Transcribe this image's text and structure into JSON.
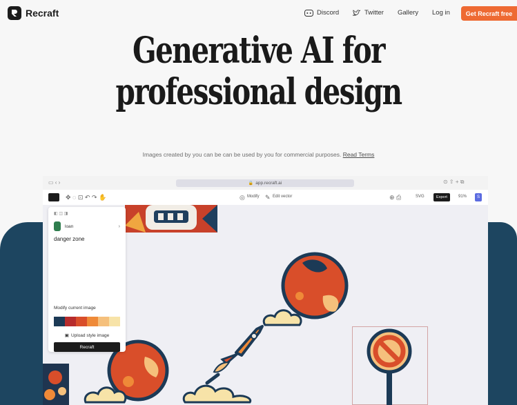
{
  "nav": {
    "brand": "Recraft",
    "links": [
      "Discord",
      "Twitter",
      "Gallery",
      "Log in"
    ],
    "cta": "Get Recraft free"
  },
  "hero": {
    "line1": "Generative AI for",
    "line2": "professional design",
    "subtitle": "Images created by you can be can be used by you for commercial purposes.",
    "subtitle_link": "Read Terms"
  },
  "app": {
    "url": "app.recraft.ai",
    "toolbar": {
      "modify": "Modify",
      "edit_vector": "Edit vector",
      "format": "SVG",
      "export": "Export",
      "zoom": "91%",
      "user_initial": "S"
    },
    "panel": {
      "project_name": "loan",
      "prompt": "danger zone",
      "modify_label": "Modify current image",
      "upload_label": "Upload style image",
      "recraft_button": "Recraft",
      "palette": [
        "#1c3a56",
        "#b72c2c",
        "#d94e2a",
        "#ef8a38",
        "#f5c07c",
        "#f7e3a8"
      ]
    }
  },
  "colors": {
    "accent": "#ee6a33",
    "navy": "#1d4560",
    "brand_dark": "#1c1c1c"
  }
}
